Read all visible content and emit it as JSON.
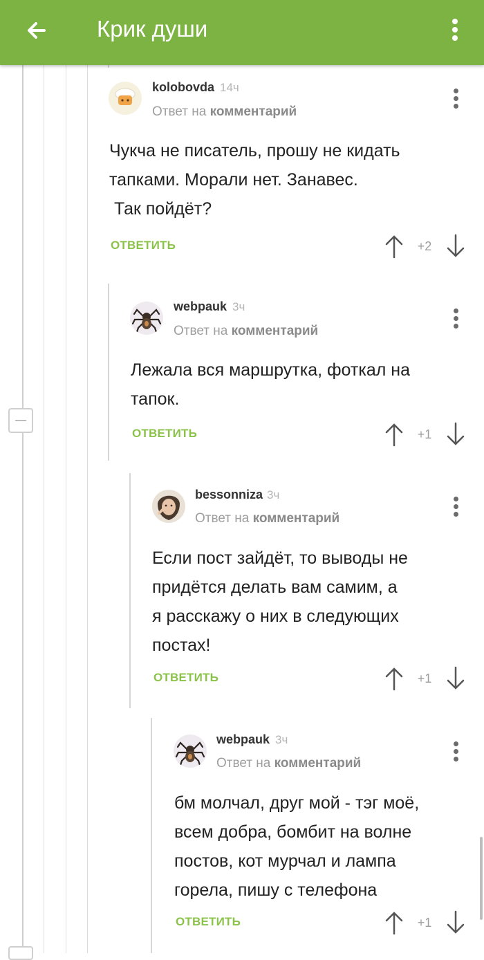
{
  "header": {
    "title": "Крик души",
    "back_icon": "arrow-left-icon",
    "menu_icon": "more-vertical-icon",
    "bg_color": "#7cb342"
  },
  "reply_label": "ОТВЕТИТЬ",
  "reply_prefix": "Ответ на",
  "reply_link": "комментарий",
  "comments": [
    {
      "author": "kolobovda",
      "time": "14ч",
      "avatar": "chef-hat-avatar",
      "text": "Чукча не писатель, прошу не кидать\nтапками. Морали нет. Занавес.\n Так пойдёт?",
      "rating": "+2"
    },
    {
      "author": "webpauk",
      "time": "3ч",
      "avatar": "tarantula-avatar",
      "text": "Лежала вся маршрутка, фоткал на\nтапок.",
      "rating": "+1"
    },
    {
      "author": "bessonniza",
      "time": "3ч",
      "avatar": "portrait-avatar",
      "text": "Если пост зайдёт, то выводы не\nпридётся делать вам самим, а\nя расскажу о них в следующих\nпостах!",
      "rating": "+1"
    },
    {
      "author": "webpauk",
      "time": "3ч",
      "avatar": "tarantula-avatar",
      "text": "бм молчал, друг мой - тэг моё,\nвсем добра, бомбит на волне\nпостов, кот мурчал и лампа\nгорела, пишу с телефона",
      "rating": "+1"
    }
  ],
  "accent_color": "#8bc34a"
}
